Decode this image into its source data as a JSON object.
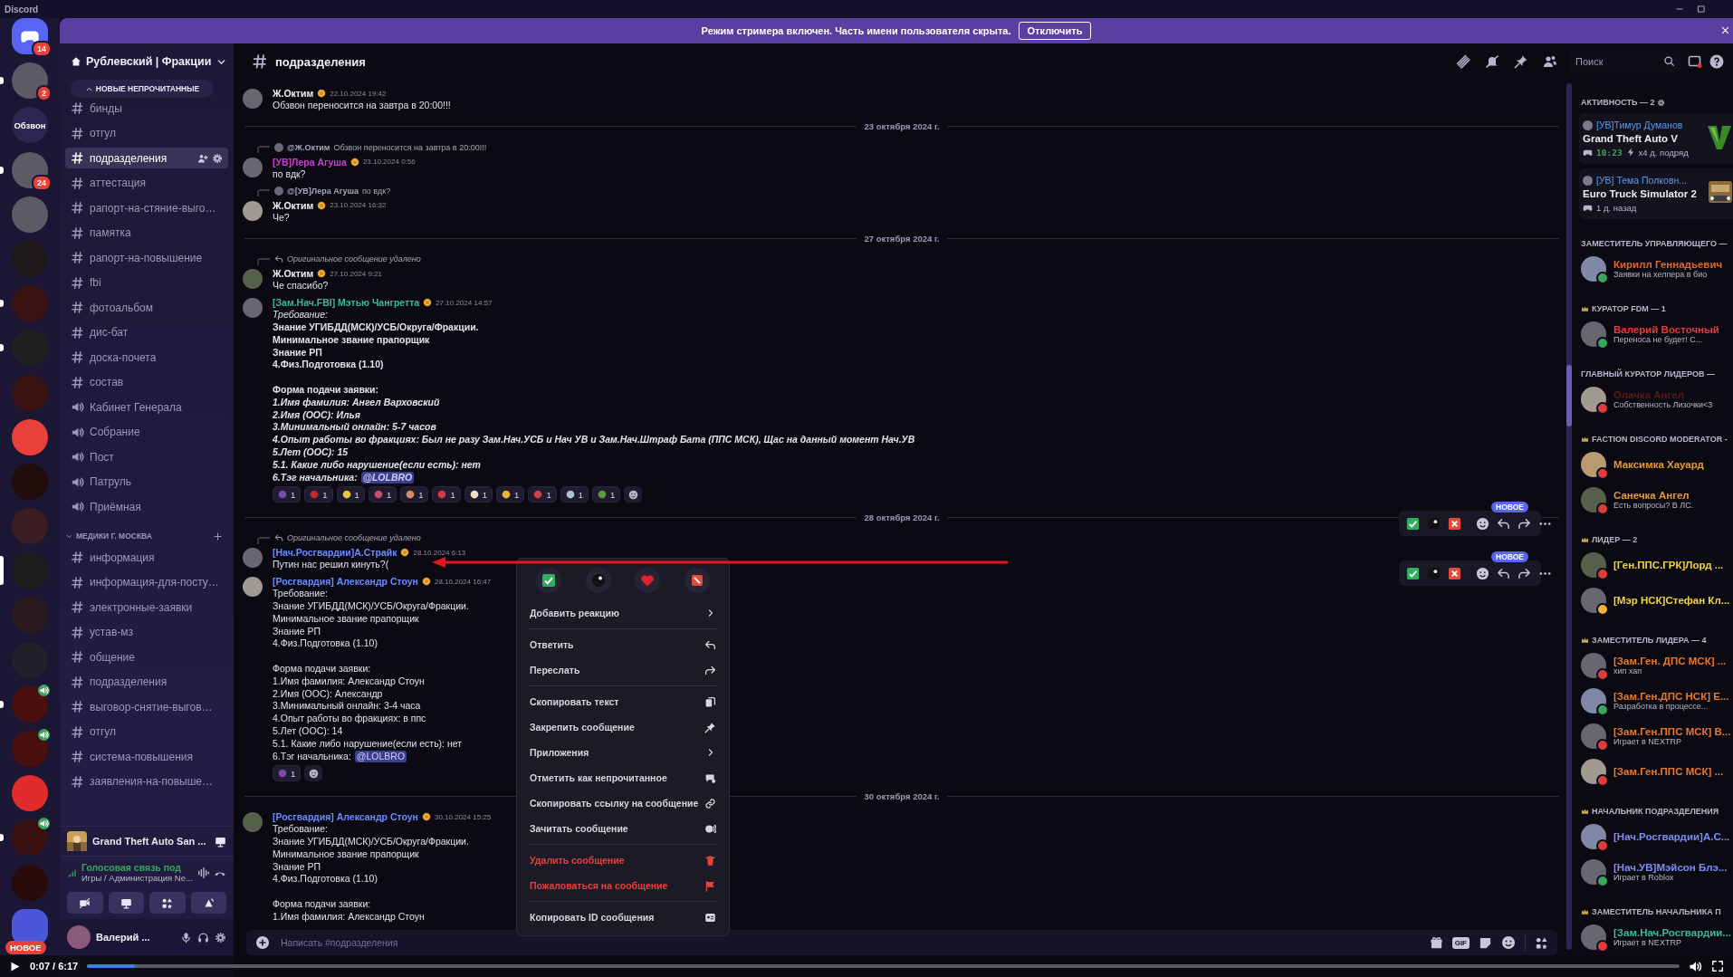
{
  "titlebar": {
    "title": "Discord"
  },
  "banner": {
    "text": "Режим стримера включен. Часть имени пользователя скрыта.",
    "button": "Отключить"
  },
  "servers": [
    {
      "kind": "home",
      "badge": "14",
      "unread": false,
      "selected": false
    },
    {
      "kind": "avatar",
      "badge": "2",
      "unread": true,
      "selected": false
    },
    {
      "kind": "text",
      "label": "Обзвон",
      "unread": false,
      "selected": false
    },
    {
      "kind": "avatar",
      "badge": "24",
      "unread": true,
      "selected": false
    },
    {
      "kind": "avatar",
      "unread": false,
      "selected": false
    },
    {
      "kind": "logo",
      "color": "#1e1718",
      "unread": false,
      "selected": false
    },
    {
      "kind": "logo",
      "color": "#3a1212",
      "unread": true,
      "selected": false
    },
    {
      "kind": "logo",
      "color": "#202020",
      "unread": true,
      "selected": false
    },
    {
      "kind": "logo",
      "color": "#3a1212",
      "unread": false,
      "selected": false
    },
    {
      "kind": "logo",
      "color": "#e8413a",
      "unread": false,
      "selected": false
    },
    {
      "kind": "logo",
      "color": "#220c0c",
      "unread": false,
      "selected": false
    },
    {
      "kind": "logo",
      "color": "#3a1c22",
      "unread": false,
      "selected": false
    },
    {
      "kind": "logo",
      "color": "#1c1c1c",
      "unread": false,
      "selected": true
    },
    {
      "kind": "logo",
      "color": "#2a1a1e",
      "unread": false,
      "selected": false
    },
    {
      "kind": "logo",
      "color": "#24202a",
      "unread": false,
      "selected": false
    },
    {
      "kind": "logo",
      "color": "#4a1010",
      "unread": true,
      "selected": false,
      "voice": true
    },
    {
      "kind": "logo",
      "color": "#4a1010",
      "unread": false,
      "selected": false,
      "voice": true
    },
    {
      "kind": "logo",
      "color": "#e22b2b",
      "unread": false,
      "selected": false
    },
    {
      "kind": "logo",
      "color": "#3a1010",
      "unread": true,
      "selected": false,
      "voice": true
    },
    {
      "kind": "logo",
      "color": "#2a0a0a",
      "unread": false,
      "selected": false
    },
    {
      "kind": "folder",
      "badge": "НОВОЕ",
      "unread": false,
      "selected": false
    }
  ],
  "sidebar": {
    "server": "Рублевский | Фракции",
    "entries": [
      {
        "kind": "new-unread",
        "text": "НОВЫЕ НЕПРОЧИТАННЫЕ"
      },
      {
        "kind": "text",
        "name": "бинды",
        "selected": false
      },
      {
        "kind": "text",
        "name": "отгул",
        "selected": false
      },
      {
        "kind": "text",
        "name": "подразделения",
        "selected": true
      },
      {
        "kind": "text",
        "name": "аттестация",
        "selected": false
      },
      {
        "kind": "text",
        "name": "рапорт-на-стяние-выго…",
        "selected": false
      },
      {
        "kind": "text",
        "name": "памятка",
        "selected": false
      },
      {
        "kind": "text",
        "name": "рапорт-на-повышение",
        "selected": false
      },
      {
        "kind": "text",
        "name": "fbi",
        "selected": false
      },
      {
        "kind": "text",
        "name": "фотоальбом",
        "selected": false
      },
      {
        "kind": "text",
        "name": "дис-бат",
        "selected": false
      },
      {
        "kind": "text",
        "name": "доска-почета",
        "selected": false
      },
      {
        "kind": "text",
        "name": "состав",
        "selected": false
      },
      {
        "kind": "voice",
        "name": "Кабинет Генерала",
        "selected": false
      },
      {
        "kind": "voice",
        "name": "Собрание",
        "selected": false
      },
      {
        "kind": "voice",
        "name": "Пост",
        "selected": false
      },
      {
        "kind": "voice",
        "name": "Патруль",
        "selected": false
      },
      {
        "kind": "voice",
        "name": "Приёмная",
        "selected": false
      },
      {
        "kind": "category",
        "name": "МЕДИКИ Г. МОСКВА",
        "expanded": true
      },
      {
        "kind": "text",
        "name": "информация",
        "selected": false
      },
      {
        "kind": "text",
        "name": "информация-для-посту…",
        "selected": false
      },
      {
        "kind": "text",
        "name": "электронные-заявки",
        "selected": false
      },
      {
        "kind": "text",
        "name": "устав-мз",
        "selected": false
      },
      {
        "kind": "text",
        "name": "общение",
        "selected": false
      },
      {
        "kind": "text",
        "name": "подразделения",
        "selected": false
      },
      {
        "kind": "text",
        "name": "выговор-снятие-выгов…",
        "selected": false
      },
      {
        "kind": "text",
        "name": "отгул",
        "selected": false
      },
      {
        "kind": "text",
        "name": "система-повышения",
        "selected": false
      },
      {
        "kind": "text",
        "name": "заявления-на-повыше…",
        "selected": false
      }
    ],
    "activity": "Grand Theft Auto San ...",
    "voice": {
      "status": "Голосовая связь под",
      "channel": "Игры / Администрация Ne..."
    },
    "user": {
      "name": "Валерий ..."
    }
  },
  "chat": {
    "channel": "подразделения",
    "search_placeholder": "Поиск",
    "input_placeholder": "Написать #подразделения",
    "gif": "GIF",
    "messages": [
      {
        "kind": "message",
        "author": "Ж.Октим",
        "color": "#f2f2f5",
        "badge": true,
        "time": "22.10.2024 19:42",
        "lines": [
          {
            "kind": "plain",
            "text": "Обзвон переносится на завтра в 20:00!!!"
          }
        ]
      },
      {
        "kind": "divider",
        "text": "23 октября 2024 г."
      },
      {
        "kind": "message",
        "reply": {
          "kind": "mention",
          "author": "@Ж.Октим",
          "text": "Обзвон переносится на завтра в 20:00!!!"
        },
        "author": "[УВ]Лера Агуша",
        "color": "#d13fd6",
        "badge": true,
        "time": "23.10.2024 0:56",
        "lines": [
          {
            "kind": "plain",
            "text": "по вдк?"
          }
        ]
      },
      {
        "kind": "message",
        "reply": {
          "kind": "mention",
          "author": "@[УВ]Лера Агуша",
          "text": "по вдк?"
        },
        "author": "Ж.Октим",
        "color": "#f2f2f5",
        "badge": true,
        "time": "23.10.2024 16:32",
        "lines": [
          {
            "kind": "plain",
            "text": "Че?"
          }
        ]
      },
      {
        "kind": "divider",
        "text": "27 октября 2024 г."
      },
      {
        "kind": "message",
        "reply": {
          "kind": "deleted",
          "text": "Оригинальное сообщение удалено"
        },
        "author": "Ж.Октим",
        "color": "#f2f2f5",
        "badge": true,
        "time": "27.10.2024 9:21",
        "lines": [
          {
            "kind": "plain",
            "text": "Че спасибо?"
          }
        ]
      },
      {
        "kind": "message",
        "author": "[Зам.Нач.FBI] Мэтью Чангретта",
        "color": "#3fb89a",
        "badge": true,
        "time": "27.10.2024 14:57",
        "lines": [
          {
            "kind": "italic",
            "text": "Требование:"
          },
          {
            "kind": "bold",
            "text": "Знание УГИБДД(МСК)/УСБ/Округа/Фракции."
          },
          {
            "kind": "bold",
            "text": "Минимальное звание прапорщик"
          },
          {
            "kind": "bold",
            "text": "Знание РП"
          },
          {
            "kind": "bold",
            "text": "4.Физ.Подготовка (1.10)"
          },
          {
            "kind": "blank"
          },
          {
            "kind": "bold",
            "text": "Форма подачи заявки:"
          },
          {
            "kind": "bold-italic",
            "text": "1.Имя фамилия: Ангел Варховский"
          },
          {
            "kind": "bold-italic",
            "text": "2.Имя (ООС): Илья"
          },
          {
            "kind": "bold-italic",
            "text": "3.Минимальный онлайн: 5-7 часов"
          },
          {
            "kind": "bold-italic",
            "text": "4.Опыт работы во фракциях: Был не разу Зам.Нач.УСБ и Нач УВ и Зам.Нач.Штраф Бата (ППС МСК), Щас на данный момент Нач.УВ"
          },
          {
            "kind": "bold-italic",
            "text": "5.Лет (ООС): 15"
          },
          {
            "kind": "bold-italic",
            "text": "5.1. Какие либо нарушение(если есть): нет"
          },
          {
            "kind": "bold-italic",
            "text": "6.Тэг начальника:",
            "mention": "@LOLBRO"
          }
        ],
        "reactions": [
          {
            "count": "1"
          },
          {
            "count": "1"
          },
          {
            "count": "1"
          },
          {
            "count": "1"
          },
          {
            "count": "1"
          },
          {
            "count": "1"
          },
          {
            "count": "1"
          },
          {
            "count": "1"
          },
          {
            "count": "1"
          },
          {
            "count": "1"
          },
          {
            "count": "1"
          }
        ]
      },
      {
        "kind": "divider",
        "text": "28 октября 2024 г."
      },
      {
        "kind": "message",
        "reply": {
          "kind": "deleted",
          "text": "Оригинальное сообщение удалено"
        },
        "author": "[Нач.Росгвардии]А.Страйк",
        "color": "#6b8cff",
        "badge": true,
        "time": "28.10.2024 6:13",
        "lines": [
          {
            "kind": "plain",
            "text": "Путин нас решил кинуть?("
          }
        ]
      },
      {
        "kind": "message",
        "author": "[Росгвардия] Александр Стоун",
        "color": "#6b8cff",
        "badge": true,
        "time": "28.10.2024 16:47",
        "lines": [
          {
            "kind": "plain",
            "text": "Требование:"
          },
          {
            "kind": "plain",
            "text": "Знание УГИБДД(МСК)/УСБ/Округа/Фракции."
          },
          {
            "kind": "plain",
            "text": "Минимальное звание прапорщик"
          },
          {
            "kind": "plain",
            "text": "Знание РП"
          },
          {
            "kind": "plain",
            "text": "4.Физ.Подготовка (1.10)"
          },
          {
            "kind": "blank"
          },
          {
            "kind": "plain",
            "text": "Форма подачи заявки:"
          },
          {
            "kind": "plain",
            "text": "1.Имя фамилия: Александр Стоун"
          },
          {
            "kind": "plain",
            "text": "2.Имя (ООС): Александр"
          },
          {
            "kind": "plain",
            "text": "3.Минимальный онлайн: 3-4 часа"
          },
          {
            "kind": "plain",
            "text": "4.Опыт работы во фракциях: в ппс"
          },
          {
            "kind": "plain",
            "text": "5.Лет (ООС): 14"
          },
          {
            "kind": "plain",
            "text": "5.1. Какие либо нарушение(если есть): нет"
          },
          {
            "kind": "plain",
            "text": "6.Тэг начальника:",
            "mention": "@LOLBRO"
          }
        ],
        "reactions": [
          {
            "count": "1"
          }
        ]
      },
      {
        "kind": "divider",
        "text": "30 октября 2024 г."
      },
      {
        "kind": "message",
        "author": "[Росгвардия] Александр Стоун",
        "color": "#6b8cff",
        "badge": true,
        "time": "30.10.2024 15:25",
        "lines": [
          {
            "kind": "plain",
            "text": "Требование:"
          },
          {
            "kind": "plain",
            "text": "Знание УГИБДД(МСК)/УСБ/Округа/Фракции."
          },
          {
            "kind": "plain",
            "text": "Минимальное звание прапорщик"
          },
          {
            "kind": "plain",
            "text": "Знание РП"
          },
          {
            "kind": "plain",
            "text": "4.Физ.Подготовка (1.10)"
          },
          {
            "kind": "blank"
          },
          {
            "kind": "plain",
            "text": "Форма подачи заявки:"
          },
          {
            "kind": "plain",
            "text": "1.Имя фамилия: Александр Стоун"
          }
        ]
      }
    ]
  },
  "toolbars": [
    {
      "badge": "НОВОЕ"
    },
    {
      "badge": "НОВОЕ"
    }
  ],
  "context_menu": {
    "groups": [
      [
        {
          "label": "Добавить реакцию",
          "kind": "submenu"
        }
      ],
      [
        {
          "label": "Ответить",
          "kind": "action"
        },
        {
          "label": "Переслать",
          "kind": "action"
        }
      ],
      [
        {
          "label": "Скопировать текст",
          "kind": "action"
        },
        {
          "label": "Закрепить сообщение",
          "kind": "action"
        },
        {
          "label": "Приложения",
          "kind": "submenu"
        },
        {
          "label": "Отметить как непрочитанное",
          "kind": "action"
        },
        {
          "label": "Скопировать ссылку на сообщение",
          "kind": "action"
        },
        {
          "label": "Зачитать сообщение",
          "kind": "action"
        }
      ],
      [
        {
          "label": "Удалить сообщение",
          "kind": "danger"
        },
        {
          "label": "Пожаловаться на сообщение",
          "kind": "danger"
        }
      ],
      [
        {
          "label": "Копировать ID сообщения",
          "kind": "action"
        }
      ]
    ]
  },
  "members": [
    {
      "kind": "activity",
      "title": "АКТИВНОСТЬ — 2",
      "cards": [
        {
          "kind": "playing",
          "name": "[УВ]Тимур Думанов",
          "game": "Grand Theft Auto V",
          "elapsed": "10:23",
          "streak": "x4 д. подряд"
        },
        {
          "kind": "recent",
          "name": "[УВ] Тема Полковн...",
          "game": "Euro Truck Simulator 2",
          "elapsed": "1 д. назад"
        }
      ]
    },
    {
      "kind": "role",
      "title": "ЗАМЕСТИТЕЛЬ УПРАВЛЯЮЩЕГО —",
      "icon": false,
      "members": [
        {
          "name": "Кирилл Геннадьевич",
          "color": "#e0662e",
          "kind": "online",
          "activity": "Заявки на хелпера в био"
        }
      ]
    },
    {
      "kind": "role",
      "title": "КУРАТОР FDM — 1",
      "icon": true,
      "members": [
        {
          "name": "Валерий Восточный",
          "color": "#e33c3c",
          "kind": "online",
          "activity": "Переноса не будет! С..."
        }
      ]
    },
    {
      "kind": "role",
      "title": "ГЛАВНЫЙ КУРАТОР ЛИДЕРОВ —",
      "icon": false,
      "members": [
        {
          "name": "Олачка Ангел",
          "color": "#5a1a1a",
          "kind": "dnd",
          "activity": "Собственность Лизочки<3"
        }
      ]
    },
    {
      "kind": "role",
      "title": "FACTION DISCORD MODERATOR -",
      "icon": true,
      "members": [
        {
          "name": "Максимка Хауард",
          "color": "#e8982e",
          "kind": "dnd"
        },
        {
          "name": "Санечка Ангел",
          "color": "#e8982e",
          "kind": "dnd",
          "activity": "Есть вопросы? В ЛС."
        }
      ]
    },
    {
      "kind": "role",
      "title": "ЛИДЕР — 2",
      "icon": true,
      "members": [
        {
          "name": "[Ген.ППС.ГРК]Лорд ...",
          "color": "#f2d43c",
          "kind": "dnd"
        },
        {
          "name": "[Мэр НСК]Стефан Кл...",
          "color": "#f2d43c",
          "kind": "idle"
        }
      ]
    },
    {
      "kind": "role",
      "title": "ЗАМЕСТИТЕЛЬ ЛИДЕРА — 4",
      "icon": true,
      "members": [
        {
          "name": "[Зам.Ген. ДПС МСК] ...",
          "color": "#e8782e",
          "kind": "dnd",
          "activity": "хип хап"
        },
        {
          "name": "[Зам.Ген.ДПС НСК] Е...",
          "color": "#e8782e",
          "kind": "online",
          "activity": "Разработка в процессе..."
        },
        {
          "name": "[Зам.Ген.ППС МСК] В...",
          "color": "#e8782e",
          "kind": "dnd",
          "activity": "Играет в NEXTRP"
        },
        {
          "name": "[Зам.Ген.ППС МСК] ...",
          "color": "#e8782e",
          "kind": "dnd"
        }
      ]
    },
    {
      "kind": "role",
      "title": "НАЧАЛЬНИК ПОДРАЗДЕЛЕНИЯ",
      "icon": true,
      "members": [
        {
          "name": "[Нач.Росгвардии]А.С...",
          "color": "#7e8cf5",
          "kind": "dnd"
        },
        {
          "name": "[Нач.УВ]Мэйсон Блэ...",
          "color": "#7e8cf5",
          "kind": "online",
          "activity": "Играет в Roblox"
        }
      ]
    },
    {
      "kind": "role",
      "title": "ЗАМЕСТИТЕЛЬ НАЧАЛЬНИКА П",
      "icon": true,
      "members": [
        {
          "name": "[Зам.Нач.Росгвардии...",
          "color": "#3cb89a",
          "kind": "dnd",
          "activity": "Играет в NEXTRP"
        }
      ]
    }
  ],
  "video": {
    "time": "0:07 / 6:17",
    "level": 0.03
  }
}
